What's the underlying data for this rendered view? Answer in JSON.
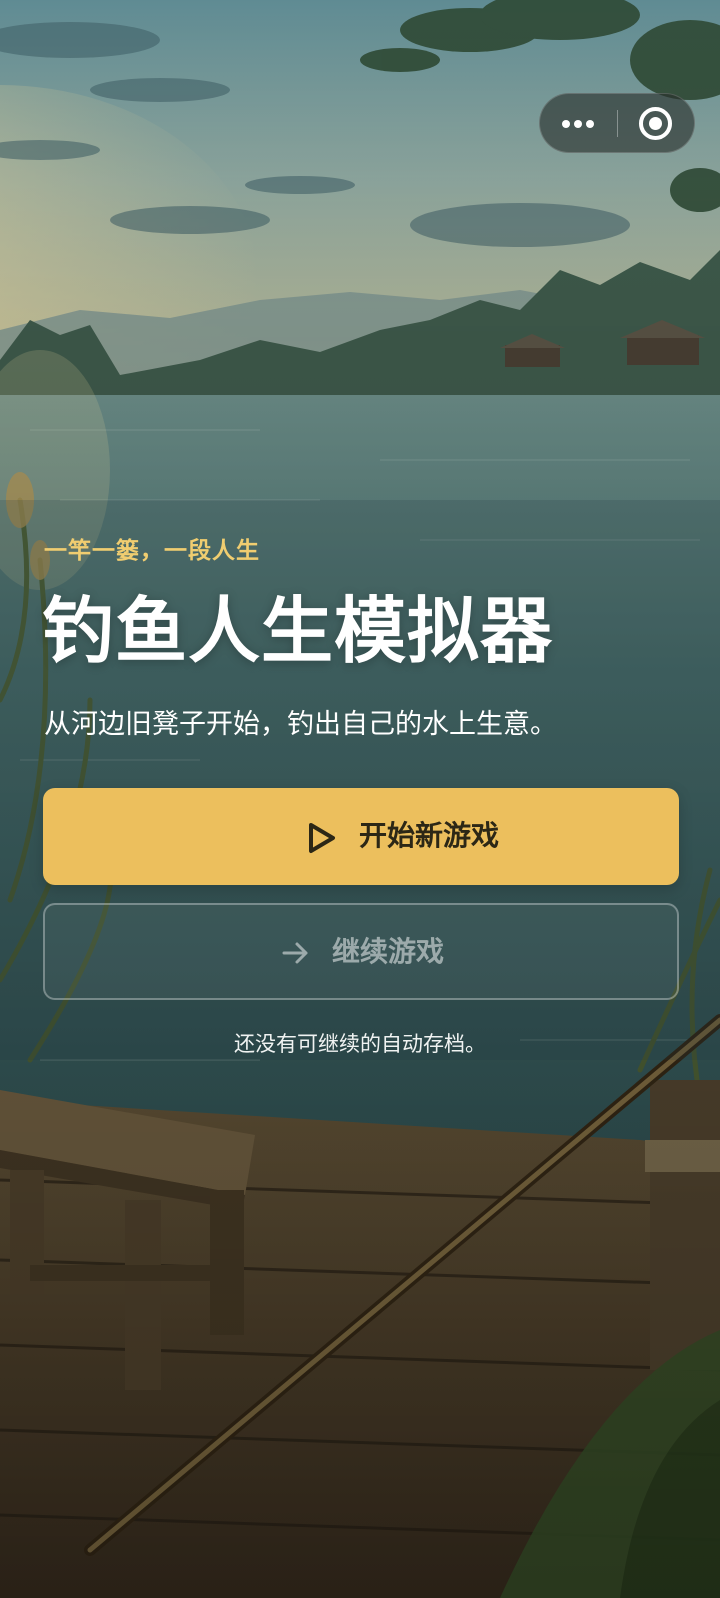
{
  "capsule": {
    "more_icon": "more-dots-icon",
    "close_icon": "target-close-icon"
  },
  "hero": {
    "tagline": "一竿一篓，一段人生",
    "title": "钓鱼人生模拟器",
    "subtitle": "从河边旧凳子开始，钓出自己的水上生意。"
  },
  "actions": {
    "start_label": "开始新游戏",
    "start_icon": "play-icon",
    "continue_label": "继续游戏",
    "continue_icon": "arrow-right-icon",
    "continue_disabled": true,
    "hint": "还没有可继续的自动存档。"
  },
  "colors": {
    "accent": "#ecbf5d",
    "tagline": "#f0cd70",
    "button_text": "#2c2716"
  }
}
